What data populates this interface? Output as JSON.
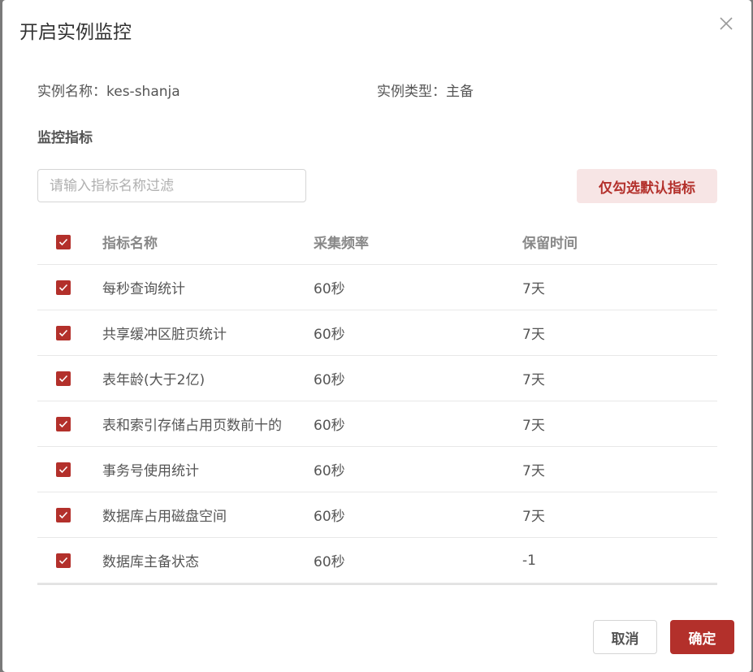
{
  "dialog": {
    "title": "开启实例监控",
    "close_icon": "close-icon"
  },
  "info": {
    "instance_name": "实例名称：kes-shanja",
    "instance_type": "实例类型：主备"
  },
  "section_title": "监控指标",
  "filter": {
    "placeholder": "请输入指标名称过滤",
    "value": ""
  },
  "default_button": "仅勾选默认指标",
  "table": {
    "columns": [
      "指标名称",
      "采集频率",
      "保留时间"
    ],
    "all_checked": true,
    "rows": [
      {
        "name": "每秒查询统计",
        "freq": "60秒",
        "retention": "7天",
        "checked": true
      },
      {
        "name": "共享缓冲区脏页统计",
        "freq": "60秒",
        "retention": "7天",
        "checked": true
      },
      {
        "name": "表年龄(大于2亿)",
        "freq": "60秒",
        "retention": "7天",
        "checked": true
      },
      {
        "name": "表和索引存储占用页数前十的",
        "freq": "60秒",
        "retention": "7天",
        "checked": true
      },
      {
        "name": "事务号使用统计",
        "freq": "60秒",
        "retention": "7天",
        "checked": true
      },
      {
        "name": "数据库占用磁盘空间",
        "freq": "60秒",
        "retention": "7天",
        "checked": true
      },
      {
        "name": "数据库主备状态",
        "freq": "60秒",
        "retention": "-1",
        "checked": true
      }
    ]
  },
  "footer": {
    "cancel": "取消",
    "confirm": "确定"
  },
  "colors": {
    "accent": "#b3302b",
    "accent_light": "#f7e5e5"
  }
}
